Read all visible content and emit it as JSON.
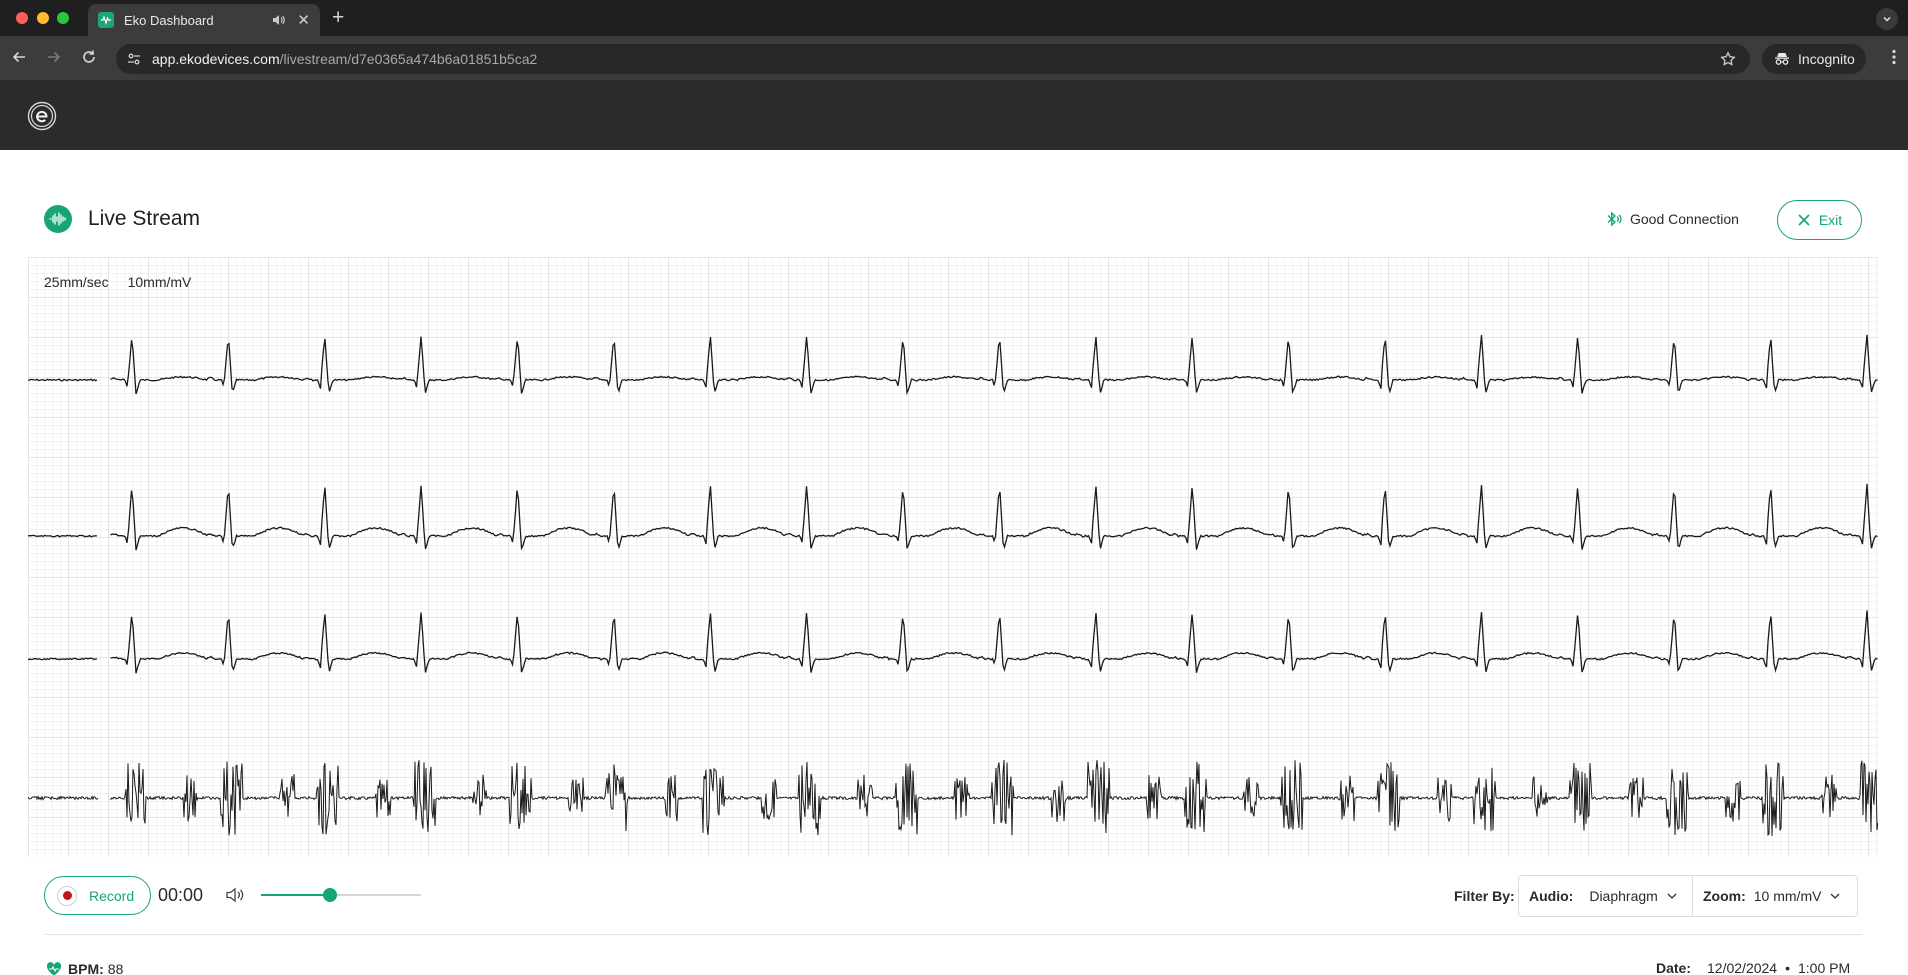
{
  "browser": {
    "tab_title": "Eko Dashboard",
    "url_host": "app.ekodevices.com",
    "url_path": "/livestream/d7e0365a474b6a01851b5ca2",
    "incognito_label": "Incognito"
  },
  "page": {
    "title": "Live Stream",
    "connection_status": "Good Connection",
    "exit_label": "Exit",
    "brand_color": "#17a673"
  },
  "ecg": {
    "paper_speed": "25mm/sec",
    "gain": "10mm/mV",
    "heart_rate_bpm": 88,
    "beat_count": 19,
    "traces": [
      "ecg-lead-1",
      "ecg-lead-2",
      "ecg-lead-3",
      "phonocardiogram"
    ]
  },
  "controls": {
    "record_label": "Record",
    "timer": "00:00",
    "volume_level": 0.43,
    "filter_by_label": "Filter By:",
    "audio_label": "Audio:",
    "audio_value": "Diaphragm",
    "zoom_label": "Zoom:",
    "zoom_value": "10 mm/mV"
  },
  "footer": {
    "bpm_label": "BPM:",
    "bpm_value": "88",
    "date_label": "Date:",
    "date_value": "12/02/2024",
    "separator": "•",
    "time_value": "1:00 PM"
  }
}
